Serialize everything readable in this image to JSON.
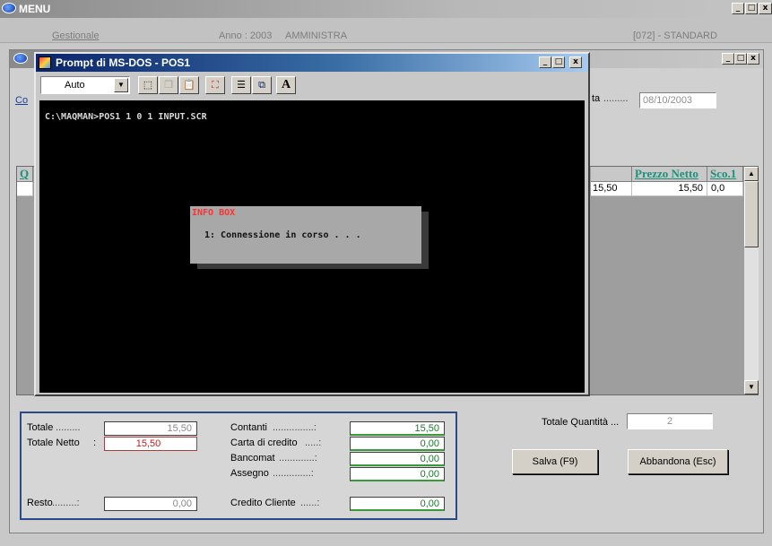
{
  "menu_window": {
    "title": "MENU",
    "info": {
      "module": "Gestionale",
      "year": "Anno : 2003",
      "user": "AMMINISTRA",
      "code": "[072] -  STANDARD"
    }
  },
  "inner_window": {
    "partial_label_top": "Co",
    "partial_label_data": "ta",
    "date_value": "08/10/2003",
    "grid": {
      "partial_col_left": "Q",
      "columns": [
        "Prezzo Netto",
        "Sco.1"
      ],
      "rows": [
        {
          "partial_prev": "15,50",
          "prezzo_netto": "15,50",
          "sconto1": "0,0"
        }
      ]
    },
    "totals": {
      "totale_label": "Totale",
      "totale_value": "15,50",
      "totale_netto_label": "Totale Netto",
      "totale_netto_value": "15,50",
      "resto_label": "Resto",
      "resto_value": "0,00",
      "payments": [
        {
          "label": "Contanti",
          "value": "15,50"
        },
        {
          "label": "Carta di credito",
          "value": "0,00"
        },
        {
          "label": "Bancomat",
          "value": "0,00"
        },
        {
          "label": "Assegno",
          "value": "0,00"
        },
        {
          "label": "Credito Cliente",
          "value": "0,00"
        }
      ]
    },
    "totale_quantita_label": "Totale Quantità ...",
    "totale_quantita_value": "2",
    "buttons": {
      "salva": "Salva (F9)",
      "abbandona": "Abbandona (Esc)"
    }
  },
  "dos_window": {
    "title": "Prompt di MS-DOS - POS1",
    "font_select": "Auto",
    "prompt_line": "C:\\MAQMAN>POS1 1 0 1 INPUT.SCR",
    "info_box": {
      "title": "INFO BOX",
      "message": "1: Connessione in corso . . ."
    }
  },
  "icons": [
    "app-logo-icon",
    "dos-app-icon",
    "minimize-icon",
    "maximize-icon",
    "close-icon",
    "scroll-up-icon",
    "scroll-down-icon"
  ],
  "colors": {
    "dos_title": "#0a246a",
    "grid_header_text": "#1e8f7a",
    "panel_border": "#2a4a8a",
    "green_value": "#1a7a2a",
    "info_box_title": "#ff3030"
  }
}
